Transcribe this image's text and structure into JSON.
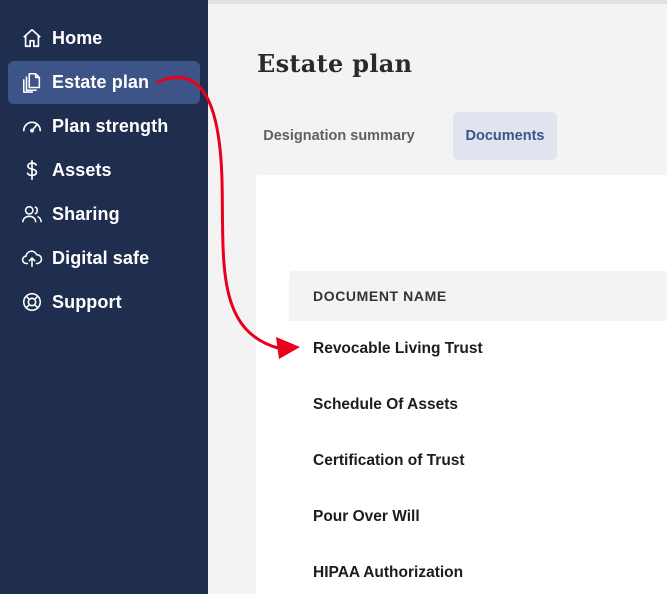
{
  "sidebar": {
    "items": [
      {
        "label": "Home",
        "icon": "home-icon"
      },
      {
        "label": "Estate plan",
        "icon": "documents-icon",
        "active": true
      },
      {
        "label": "Plan strength",
        "icon": "gauge-icon"
      },
      {
        "label": "Assets",
        "icon": "dollar-icon"
      },
      {
        "label": "Sharing",
        "icon": "users-icon"
      },
      {
        "label": "Digital safe",
        "icon": "cloud-upload-icon"
      },
      {
        "label": "Support",
        "icon": "lifebuoy-icon"
      }
    ]
  },
  "main": {
    "title": "Estate plan",
    "tabs": [
      {
        "label": "Designation summary",
        "active": false
      },
      {
        "label": "Documents",
        "active": true
      }
    ],
    "table": {
      "header": "DOCUMENT NAME",
      "rows": [
        "Revocable Living Trust",
        "Schedule Of Assets",
        "Certification of Trust",
        "Pour Over Will",
        "HIPAA Authorization"
      ]
    }
  },
  "colors": {
    "sidebar_bg": "#1f2d4e",
    "sidebar_active": "#3d5489",
    "tab_active_bg": "#dfe4ee",
    "annotation_arrow": "#e8001c"
  }
}
